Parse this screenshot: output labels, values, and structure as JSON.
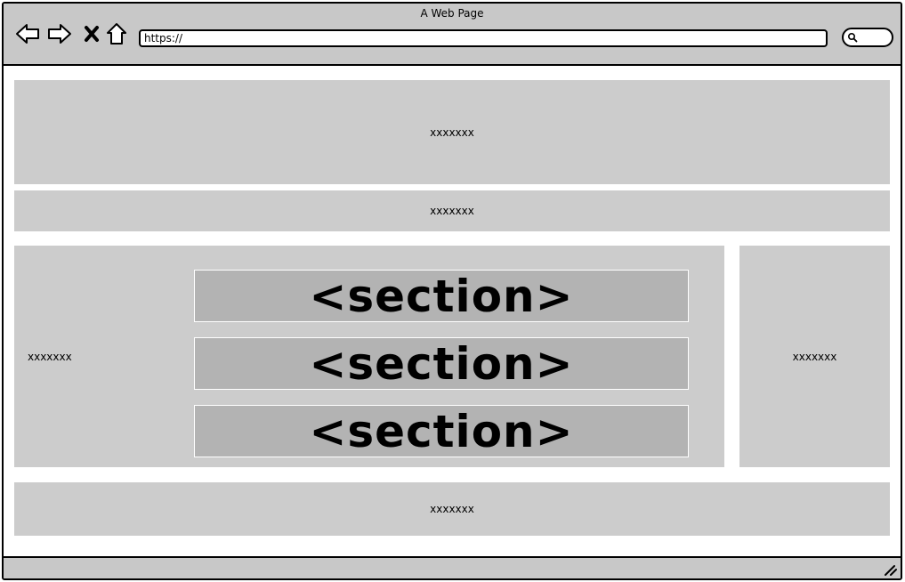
{
  "window": {
    "title": "A Web Page"
  },
  "toolbar": {
    "back_icon": "arrow-left-icon",
    "forward_icon": "arrow-right-icon",
    "stop_icon": "close-icon",
    "home_icon": "home-icon",
    "url": "https://",
    "search_icon": "search-icon"
  },
  "page": {
    "header_text": "xxxxxxx",
    "nav_text": "xxxxxxx",
    "main_text": "xxxxxxx",
    "sections": [
      "<section>",
      "<section>",
      "<section>"
    ],
    "aside_text": "xxxxxxx",
    "footer_text": "xxxxxxx"
  },
  "colors": {
    "chrome": "#c8c8c8",
    "block": "#cccccc",
    "section": "#b3b3b3"
  }
}
